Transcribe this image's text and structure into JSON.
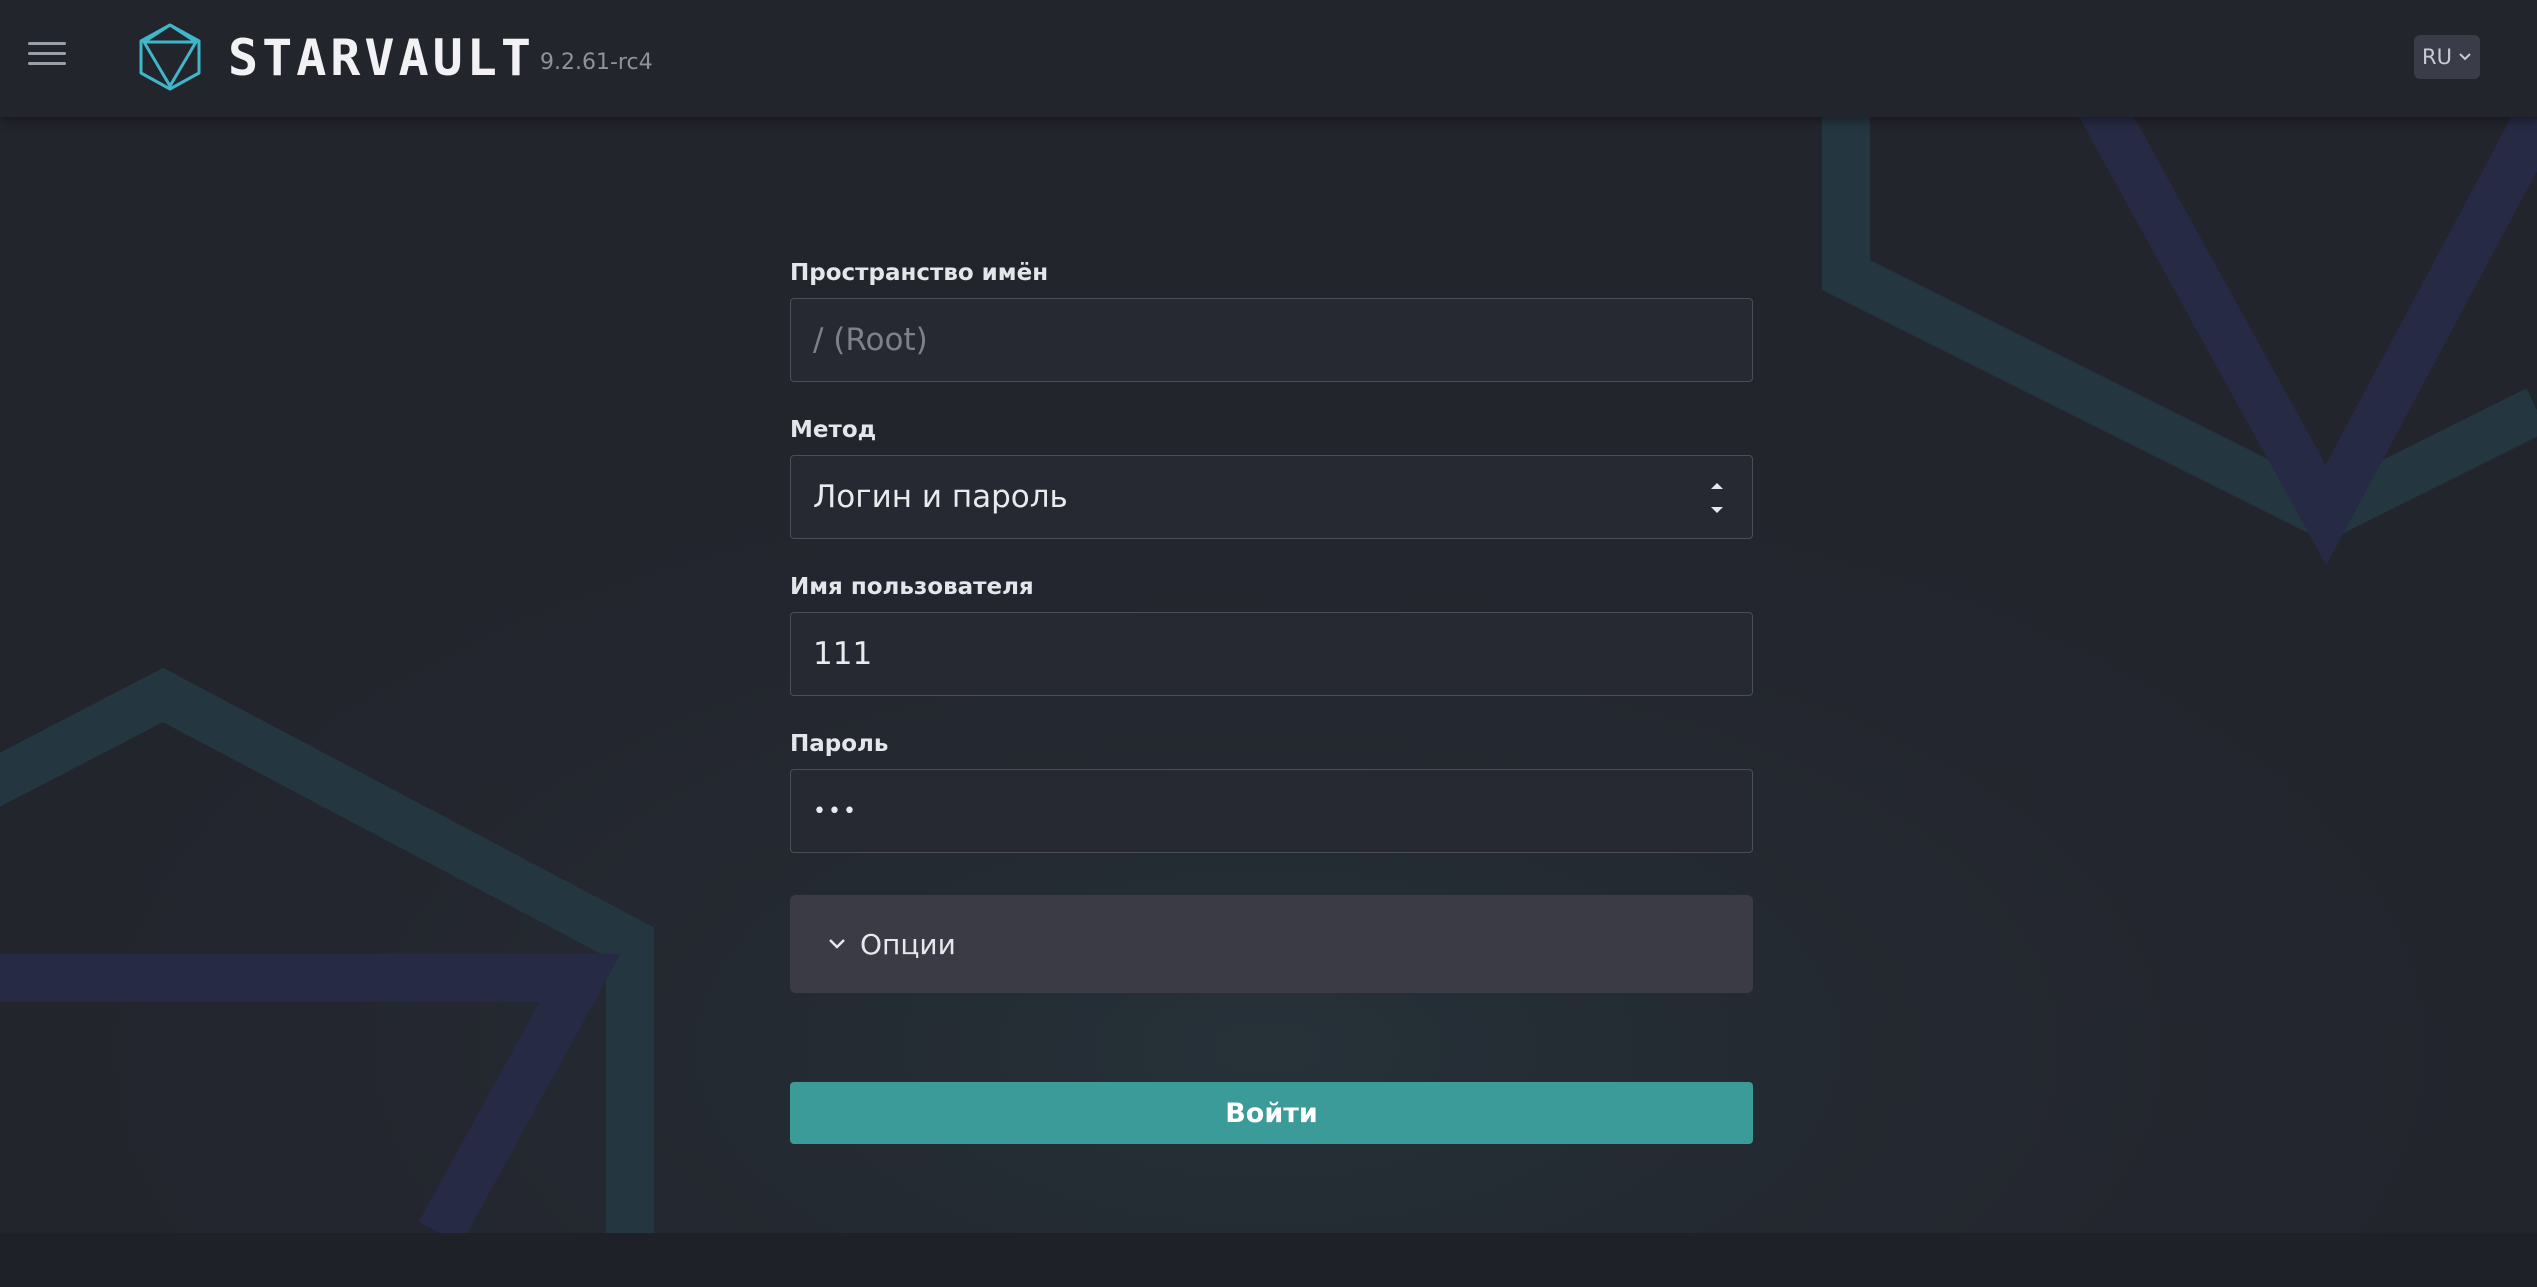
{
  "header": {
    "brand": "STARVAULT",
    "version": "9.2.61-rc4",
    "language": "RU"
  },
  "form": {
    "namespace": {
      "label": "Пространство имён",
      "placeholder": "/ (Root)",
      "value": ""
    },
    "method": {
      "label": "Метод",
      "selected": "Логин и пароль"
    },
    "username": {
      "label": "Имя пользователя",
      "value": "111"
    },
    "password": {
      "label": "Пароль",
      "masked": "•••"
    },
    "options_label": "Опции",
    "submit_label": "Войти"
  },
  "colors": {
    "accent": "#3a9b98",
    "background": "#23252d",
    "logo": "#3fb7c9"
  },
  "icons": {
    "menu": "hamburger-icon",
    "logo": "polyhedron-logo-icon",
    "language_chevron": "chevron-down-icon",
    "select_arrows": "select-arrows-icon",
    "options_chevron": "chevron-down-icon"
  }
}
